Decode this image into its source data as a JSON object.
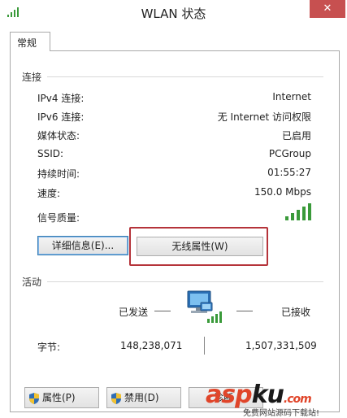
{
  "window": {
    "title": "WLAN 状态",
    "close_glyph": "✕"
  },
  "tabs": [
    {
      "label": "常规"
    }
  ],
  "connection": {
    "group_label": "连接",
    "rows": [
      {
        "label": "IPv4 连接:",
        "value": "Internet"
      },
      {
        "label": "IPv6 连接:",
        "value": "无 Internet 访问权限"
      },
      {
        "label": "媒体状态:",
        "value": "已启用"
      },
      {
        "label": "SSID:",
        "value": "PCGroup"
      },
      {
        "label": "持续时间:",
        "value": "01:55:27"
      },
      {
        "label": "速度:",
        "value": "150.0 Mbps"
      }
    ],
    "signal_label": "信号质量:",
    "signal_bars": 5,
    "details_button": "详细信息(E)...",
    "wireless_button": "无线属性(W)"
  },
  "activity": {
    "group_label": "活动",
    "sent_label": "已发送",
    "received_label": "已接收",
    "bytes_label": "字节:",
    "bytes_sent": "148,238,071",
    "bytes_received": "1,507,331,509"
  },
  "bottom_buttons": {
    "properties": "属性(P)",
    "disable": "禁用(D)",
    "diagnose": "诊断"
  },
  "watermark": {
    "brand_a": "asp",
    "brand_b": "ku",
    "brand_c": ".com",
    "sub": "免费网站源码下载站!"
  },
  "colors": {
    "accent_blue": "#3c7fb1",
    "highlight_red": "#b5333a",
    "signal_green": "#3a9a3a",
    "close_red": "#c75050"
  }
}
